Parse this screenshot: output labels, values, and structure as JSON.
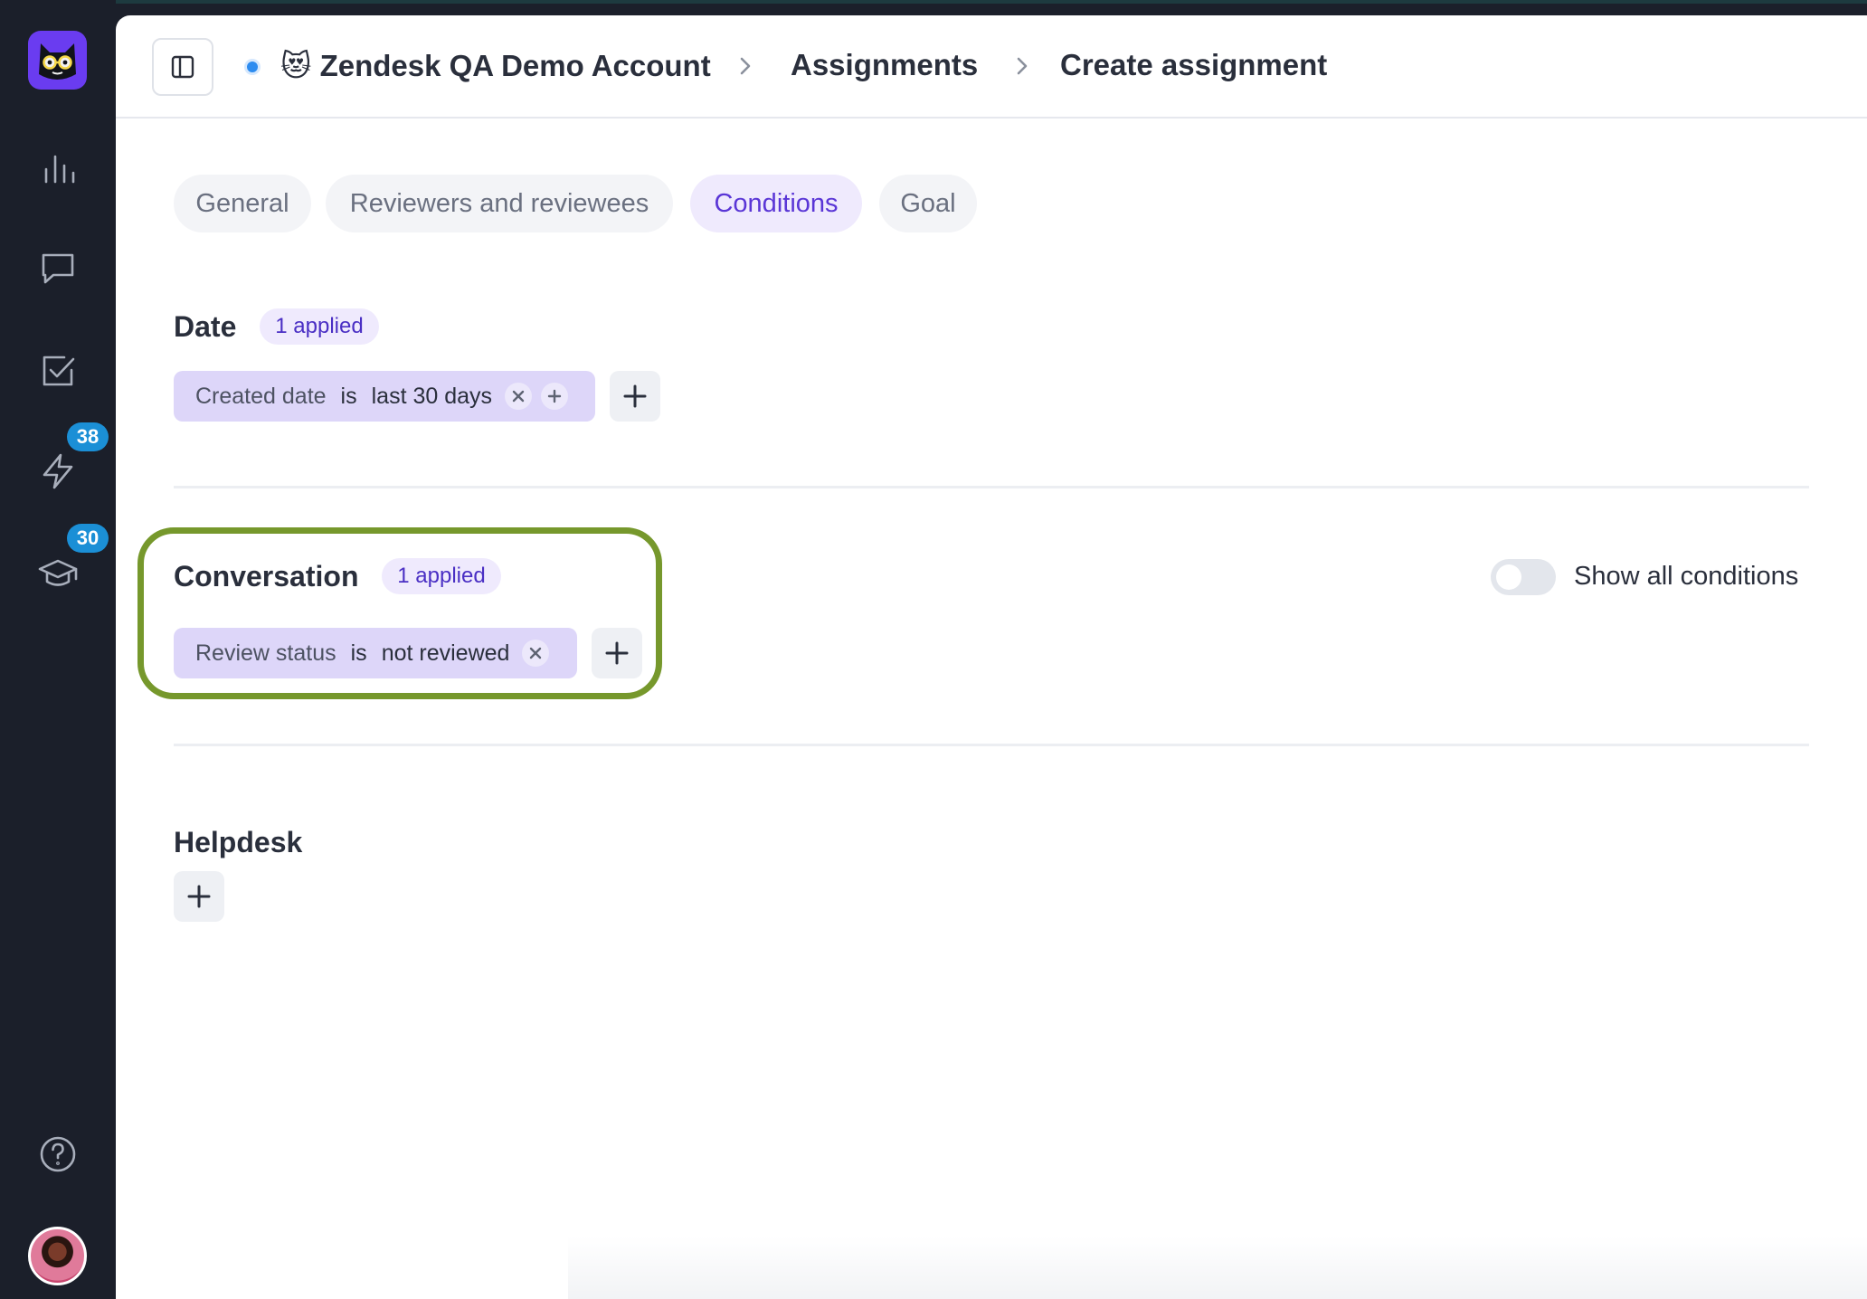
{
  "sidebar": {
    "items": [
      {
        "name": "analytics",
        "icon": "bar-chart-icon"
      },
      {
        "name": "conversations",
        "icon": "chat-bubble-icon"
      },
      {
        "name": "assignments",
        "icon": "checkbox-icon"
      },
      {
        "name": "spotlight",
        "icon": "lightning-icon",
        "badge": "38"
      },
      {
        "name": "training",
        "icon": "graduation-cap-icon",
        "badge": "30"
      }
    ],
    "help_icon": "question-circle-icon",
    "badge_color": "#1b8fd6"
  },
  "breadcrumb": {
    "account": "😻 Zendesk QA Demo Account",
    "section": "Assignments",
    "page": "Create assignment"
  },
  "tabs": [
    {
      "label": "General",
      "active": false
    },
    {
      "label": "Reviewers and reviewees",
      "active": false
    },
    {
      "label": "Conditions",
      "active": true
    },
    {
      "label": "Goal",
      "active": false
    }
  ],
  "date_section": {
    "title": "Date",
    "applied": "1 applied",
    "condition": {
      "field": "Created date",
      "operator": "is",
      "value": "last 30 days"
    }
  },
  "conversation_section": {
    "title": "Conversation",
    "applied": "1 applied",
    "condition": {
      "field": "Review status",
      "operator": "is",
      "value": "not reviewed"
    },
    "toggle_label": "Show all conditions",
    "toggle_on": false
  },
  "helpdesk_section": {
    "title": "Helpdesk"
  },
  "colors": {
    "accent": "#5a36d6",
    "chip_bg": "#ddd6f9",
    "highlight": "#76982c"
  }
}
